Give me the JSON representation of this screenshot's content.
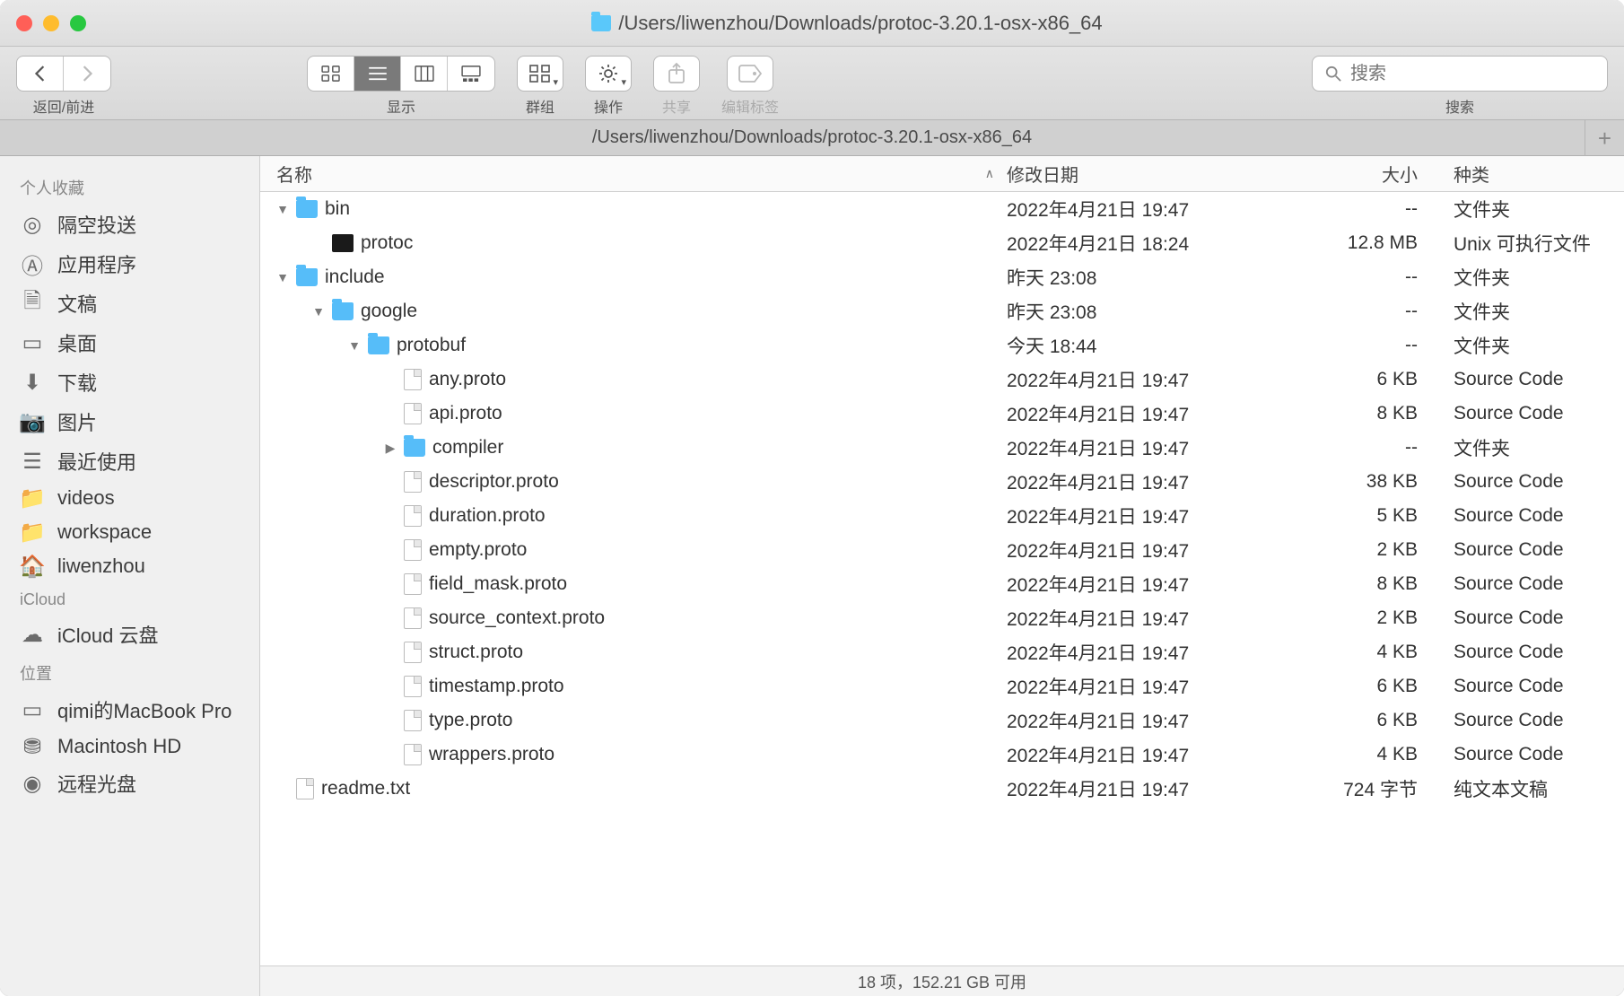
{
  "window": {
    "title_path": "/Users/liwenzhou/Downloads/protoc-3.20.1-osx-x86_64"
  },
  "toolbar": {
    "nav_label": "返回/前进",
    "view_label": "显示",
    "group_label": "群组",
    "action_label": "操作",
    "share_label": "共享",
    "tags_label": "编辑标签",
    "search_label": "搜索",
    "search_placeholder": "搜索"
  },
  "tab": {
    "path": "/Users/liwenzhou/Downloads/protoc-3.20.1-osx-x86_64"
  },
  "columns": {
    "name": "名称",
    "date": "修改日期",
    "size": "大小",
    "kind": "种类"
  },
  "sidebar": {
    "favorites_header": "个人收藏",
    "favorites": [
      {
        "icon": "airdrop",
        "label": "隔空投送"
      },
      {
        "icon": "apps",
        "label": "应用程序"
      },
      {
        "icon": "docs",
        "label": "文稿"
      },
      {
        "icon": "desktop",
        "label": "桌面"
      },
      {
        "icon": "downloads",
        "label": "下载"
      },
      {
        "icon": "pictures",
        "label": "图片"
      },
      {
        "icon": "recents",
        "label": "最近使用"
      },
      {
        "icon": "folder",
        "label": "videos"
      },
      {
        "icon": "folder",
        "label": "workspace"
      },
      {
        "icon": "home",
        "label": "liwenzhou"
      }
    ],
    "icloud_header": "iCloud",
    "icloud": [
      {
        "icon": "cloud",
        "label": "iCloud 云盘"
      }
    ],
    "locations_header": "位置",
    "locations": [
      {
        "icon": "laptop",
        "label": "qimi的MacBook Pro"
      },
      {
        "icon": "hdd",
        "label": "Macintosh HD"
      },
      {
        "icon": "disc",
        "label": "远程光盘"
      }
    ]
  },
  "rows": [
    {
      "indent": 0,
      "disc": "down",
      "icon": "folder",
      "name": "bin",
      "date": "2022年4月21日 19:47",
      "size": "--",
      "kind": "文件夹"
    },
    {
      "indent": 1,
      "disc": "",
      "icon": "exec",
      "name": "protoc",
      "date": "2022年4月21日 18:24",
      "size": "12.8 MB",
      "kind": "Unix 可执行文件"
    },
    {
      "indent": 0,
      "disc": "down",
      "icon": "folder",
      "name": "include",
      "date": "昨天 23:08",
      "size": "--",
      "kind": "文件夹"
    },
    {
      "indent": 1,
      "disc": "down",
      "icon": "folder",
      "name": "google",
      "date": "昨天 23:08",
      "size": "--",
      "kind": "文件夹"
    },
    {
      "indent": 2,
      "disc": "down",
      "icon": "folder",
      "name": "protobuf",
      "date": "今天 18:44",
      "size": "--",
      "kind": "文件夹"
    },
    {
      "indent": 3,
      "disc": "",
      "icon": "file",
      "name": "any.proto",
      "date": "2022年4月21日 19:47",
      "size": "6 KB",
      "kind": "Source Code"
    },
    {
      "indent": 3,
      "disc": "",
      "icon": "file",
      "name": "api.proto",
      "date": "2022年4月21日 19:47",
      "size": "8 KB",
      "kind": "Source Code"
    },
    {
      "indent": 3,
      "disc": "right",
      "icon": "folder",
      "name": "compiler",
      "date": "2022年4月21日 19:47",
      "size": "--",
      "kind": "文件夹"
    },
    {
      "indent": 3,
      "disc": "",
      "icon": "file",
      "name": "descriptor.proto",
      "date": "2022年4月21日 19:47",
      "size": "38 KB",
      "kind": "Source Code"
    },
    {
      "indent": 3,
      "disc": "",
      "icon": "file",
      "name": "duration.proto",
      "date": "2022年4月21日 19:47",
      "size": "5 KB",
      "kind": "Source Code"
    },
    {
      "indent": 3,
      "disc": "",
      "icon": "file",
      "name": "empty.proto",
      "date": "2022年4月21日 19:47",
      "size": "2 KB",
      "kind": "Source Code"
    },
    {
      "indent": 3,
      "disc": "",
      "icon": "file",
      "name": "field_mask.proto",
      "date": "2022年4月21日 19:47",
      "size": "8 KB",
      "kind": "Source Code"
    },
    {
      "indent": 3,
      "disc": "",
      "icon": "file",
      "name": "source_context.proto",
      "date": "2022年4月21日 19:47",
      "size": "2 KB",
      "kind": "Source Code"
    },
    {
      "indent": 3,
      "disc": "",
      "icon": "file",
      "name": "struct.proto",
      "date": "2022年4月21日 19:47",
      "size": "4 KB",
      "kind": "Source Code"
    },
    {
      "indent": 3,
      "disc": "",
      "icon": "file",
      "name": "timestamp.proto",
      "date": "2022年4月21日 19:47",
      "size": "6 KB",
      "kind": "Source Code"
    },
    {
      "indent": 3,
      "disc": "",
      "icon": "file",
      "name": "type.proto",
      "date": "2022年4月21日 19:47",
      "size": "6 KB",
      "kind": "Source Code"
    },
    {
      "indent": 3,
      "disc": "",
      "icon": "file",
      "name": "wrappers.proto",
      "date": "2022年4月21日 19:47",
      "size": "4 KB",
      "kind": "Source Code"
    },
    {
      "indent": 0,
      "disc": "",
      "icon": "file",
      "name": "readme.txt",
      "date": "2022年4月21日 19:47",
      "size": "724 字节",
      "kind": "纯文本文稿"
    }
  ],
  "status": "18 项，152.21 GB 可用"
}
